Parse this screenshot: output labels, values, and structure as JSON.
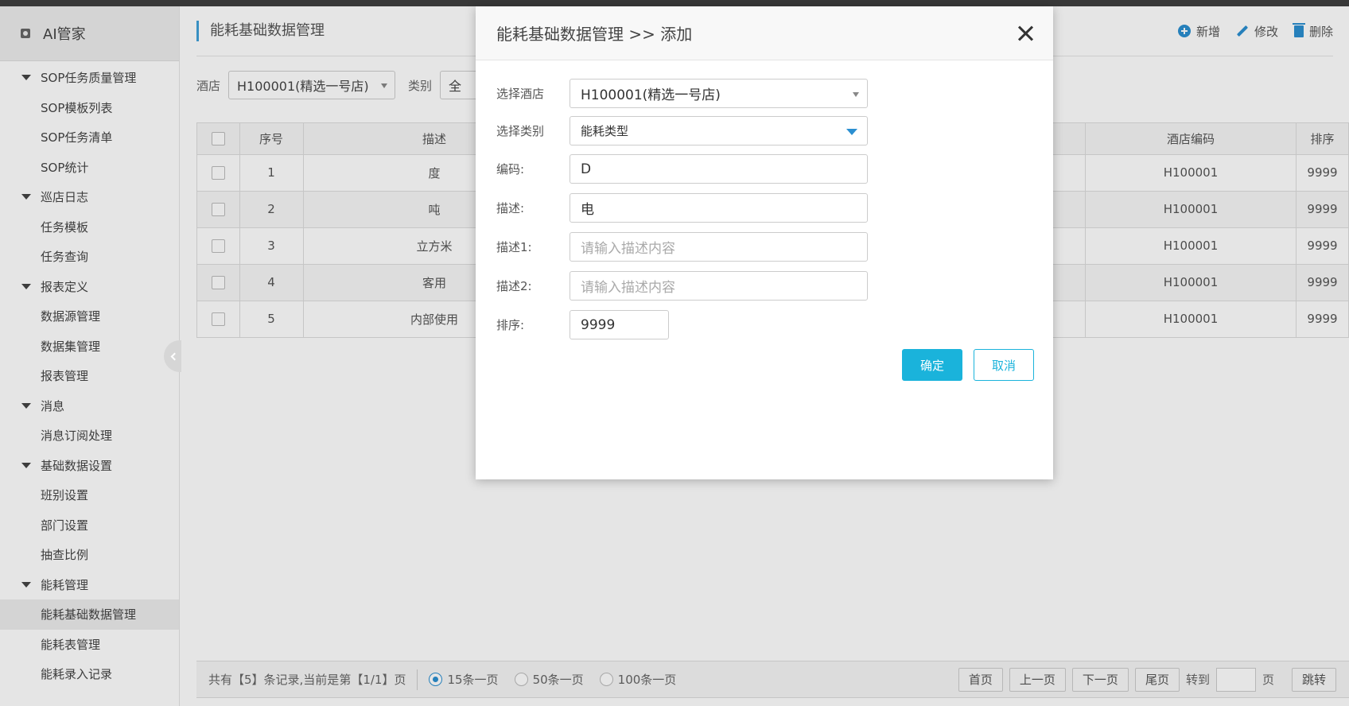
{
  "brand": {
    "title": "AI管家",
    "icon": "logo-icon"
  },
  "sidebar": {
    "items": [
      {
        "type": "group",
        "label": "SOP任务质量管理"
      },
      {
        "type": "child",
        "label": "SOP模板列表"
      },
      {
        "type": "child",
        "label": "SOP任务清单"
      },
      {
        "type": "child",
        "label": "SOP统计"
      },
      {
        "type": "group",
        "label": "巡店日志"
      },
      {
        "type": "child",
        "label": "任务模板"
      },
      {
        "type": "child",
        "label": "任务查询"
      },
      {
        "type": "group",
        "label": "报表定义"
      },
      {
        "type": "child",
        "label": "数据源管理"
      },
      {
        "type": "child",
        "label": "数据集管理"
      },
      {
        "type": "child",
        "label": "报表管理"
      },
      {
        "type": "group",
        "label": "消息"
      },
      {
        "type": "child",
        "label": "消息订阅处理"
      },
      {
        "type": "group",
        "label": "基础数据设置"
      },
      {
        "type": "child",
        "label": "班别设置"
      },
      {
        "type": "child",
        "label": "部门设置"
      },
      {
        "type": "child",
        "label": "抽查比例"
      },
      {
        "type": "group",
        "label": "能耗管理"
      },
      {
        "type": "child",
        "label": "能耗基础数据管理",
        "active": true
      },
      {
        "type": "child",
        "label": "能耗表管理"
      },
      {
        "type": "child",
        "label": "能耗录入记录"
      }
    ]
  },
  "header": {
    "title": "能耗基础数据管理",
    "actions": {
      "add": "新增",
      "edit": "修改",
      "delete": "删除"
    }
  },
  "filter": {
    "hotel_label": "酒店",
    "hotel_value": "H100001(精选一号店)",
    "category_label": "类别",
    "category_value": "全"
  },
  "table": {
    "columns": {
      "seq": "序号",
      "desc": "描述",
      "hotel_code": "酒店编码",
      "sort": "排序"
    },
    "rows": [
      {
        "seq": "1",
        "desc": "度",
        "hotel_code": "H100001",
        "sort": "9999"
      },
      {
        "seq": "2",
        "desc": "吨",
        "hotel_code": "H100001",
        "sort": "9999"
      },
      {
        "seq": "3",
        "desc": "立方米",
        "hotel_code": "H100001",
        "sort": "9999"
      },
      {
        "seq": "4",
        "desc": "客用",
        "hotel_code": "H100001",
        "sort": "9999"
      },
      {
        "seq": "5",
        "desc": "内部使用",
        "hotel_code": "H100001",
        "sort": "9999"
      }
    ]
  },
  "footer": {
    "summary": "共有【5】条记录,当前是第【1/1】页",
    "page_sizes": [
      "15条一页",
      "50条一页",
      "100条一页"
    ],
    "selected_page_size": "15条一页",
    "first": "首页",
    "prev": "上一页",
    "next": "下一页",
    "last": "尾页",
    "goto_label": "转到",
    "page_unit": "页",
    "jump": "跳转"
  },
  "modal": {
    "title": "能耗基础数据管理 >> 添加",
    "fields": {
      "hotel": {
        "label": "选择酒店",
        "value": "H100001(精选一号店)"
      },
      "category": {
        "label": "选择类别",
        "value": "能耗类型"
      },
      "code": {
        "label": "编码:",
        "value": "D"
      },
      "desc": {
        "label": "描述:",
        "value": "电"
      },
      "desc1": {
        "label": "描述1:",
        "placeholder": "请输入描述内容"
      },
      "desc2": {
        "label": "描述2:",
        "placeholder": "请输入描述内容"
      },
      "sort": {
        "label": "排序:",
        "value": "9999"
      }
    },
    "confirm": "确定",
    "cancel": "取消"
  },
  "colors": {
    "accent": "#1ab3db",
    "icon_blue": "#2b8fd1",
    "title_bar": "#3fa0d8"
  }
}
